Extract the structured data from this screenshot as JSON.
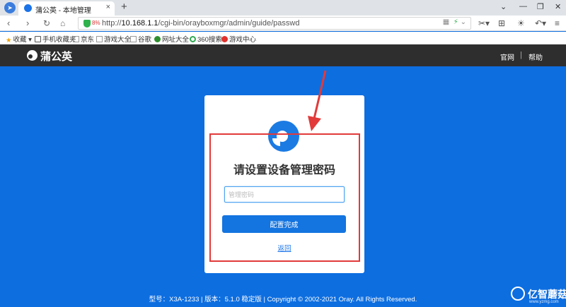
{
  "browser": {
    "tab_title": "蒲公英 - 本地管理",
    "tab_close": "×",
    "new_tab": "+",
    "url_prefix": "http://",
    "url_host": "10.168.1.1",
    "url_path": "/cgi-bin/orayboxmgr/admin/guide/passwd",
    "security_badge": "8%",
    "window_controls": [
      "⌄",
      "—",
      "❐",
      "✕"
    ],
    "toolbar_icons": [
      "scissors-icon",
      "grid-icon",
      "brightness-icon",
      "undo-icon",
      "menu-icon"
    ]
  },
  "bookmarks": [
    {
      "label": "收藏",
      "icon": "star-icon",
      "color": "#f0a30a"
    },
    {
      "label": "手机收藏夹",
      "icon": "folder-icon",
      "color": "#555555"
    },
    {
      "label": "京东",
      "icon": "page-icon",
      "color": "#999999"
    },
    {
      "label": "游戏大全",
      "icon": "page-icon",
      "color": "#999999"
    },
    {
      "label": "谷歌",
      "icon": "page-icon",
      "color": "#999999"
    },
    {
      "label": "网址大全",
      "icon": "globe-icon",
      "color": "#2f8f2f"
    },
    {
      "label": "360搜索",
      "icon": "search-360-icon",
      "color": "#2fa84f"
    },
    {
      "label": "游戏中心",
      "icon": "game-icon",
      "color": "#e0312e"
    }
  ],
  "header": {
    "brand": "蒲公英",
    "links": [
      "官网",
      "帮助"
    ],
    "separator": "|"
  },
  "card": {
    "title": "请设置设备管理密码",
    "password_placeholder": "管理密码",
    "password_value": "",
    "submit_label": "配置完成",
    "back_label": "返回"
  },
  "footer": {
    "text": "型号：X3A-1233    |    版本：5.1.0 稳定版    |    Copyright © 2002-2021 Oray. All Rights Reserved."
  },
  "watermark": {
    "name": "亿智蘑菇",
    "domain": "www.yzmg.com"
  },
  "colors": {
    "page_bg": "#0d6ee0",
    "header_bg": "#2e2e2e",
    "primary_button": "#1474e0",
    "annotation_red": "#e23a3a"
  }
}
